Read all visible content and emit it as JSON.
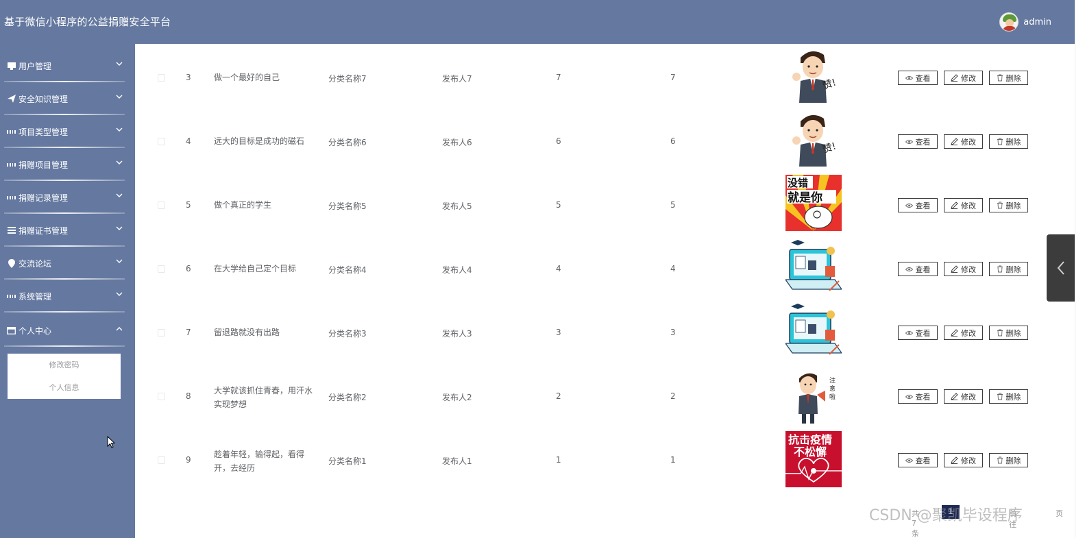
{
  "app": {
    "title": "基于微信小程序的公益捐赠安全平台",
    "user": "admin"
  },
  "sidebar": {
    "items": [
      {
        "label": "用户管理",
        "icon": "monitor-icon"
      },
      {
        "label": "安全知识管理",
        "icon": "paper-plane-icon"
      },
      {
        "label": "项目类型管理",
        "icon": "grid-icon"
      },
      {
        "label": "捐赠项目管理",
        "icon": "grid-icon"
      },
      {
        "label": "捐赠记录管理",
        "icon": "grid-icon"
      },
      {
        "label": "捐赠证书管理",
        "icon": "list-icon"
      },
      {
        "label": "交流论坛",
        "icon": "location-pin-icon"
      },
      {
        "label": "系统管理",
        "icon": "grid-icon"
      },
      {
        "label": "个人中心",
        "icon": "card-icon"
      }
    ],
    "submenu": [
      "修改密码",
      "个人信息"
    ]
  },
  "table": {
    "rows": [
      {
        "index": "3",
        "title": "做一个最好的自己",
        "category": "分类名称7",
        "publisher": "发布人7",
        "n1": "7",
        "n2": "7",
        "image": "cartoon-businessman-thumbs-up"
      },
      {
        "index": "4",
        "title": "远大的目标是成功的磁石",
        "category": "分类名称6",
        "publisher": "发布人6",
        "n1": "6",
        "n2": "6",
        "image": "cartoon-businessman-thumbs-up"
      },
      {
        "index": "5",
        "title": "做个真正的学生",
        "category": "分类名称5",
        "publisher": "发布人5",
        "n1": "5",
        "n2": "5",
        "image": "sticker-pointing-finger"
      },
      {
        "index": "6",
        "title": "在大学给自己定个目标",
        "category": "分类名称4",
        "publisher": "发布人4",
        "n1": "4",
        "n2": "4",
        "image": "online-education-laptop"
      },
      {
        "index": "7",
        "title": "留退路就没有出路",
        "category": "分类名称3",
        "publisher": "发布人3",
        "n1": "3",
        "n2": "3",
        "image": "online-education-laptop"
      },
      {
        "index": "8",
        "title": "大学就该抓住青春，用汗水实现梦想",
        "category": "分类名称2",
        "publisher": "发布人2",
        "n1": "2",
        "n2": "2",
        "image": "cartoon-businessman-megaphone"
      },
      {
        "index": "9",
        "title": "趁着年轻，输得起，看得开，去经历",
        "category": "分类名称1",
        "publisher": "发布人1",
        "n1": "1",
        "n2": "1",
        "image": "anti-epidemic-poster"
      }
    ],
    "actions": {
      "view": "查看",
      "edit": "修改",
      "delete": "删除"
    }
  },
  "pager": {
    "total": "共 7 条",
    "current": "1",
    "prev": "前往",
    "next": "页"
  },
  "watermark": "CSDN @聚凯毕设程序",
  "colors": {
    "topbar": "#6478a0",
    "sidebar": "#6478a0",
    "pager_active": "#1e2a55"
  }
}
